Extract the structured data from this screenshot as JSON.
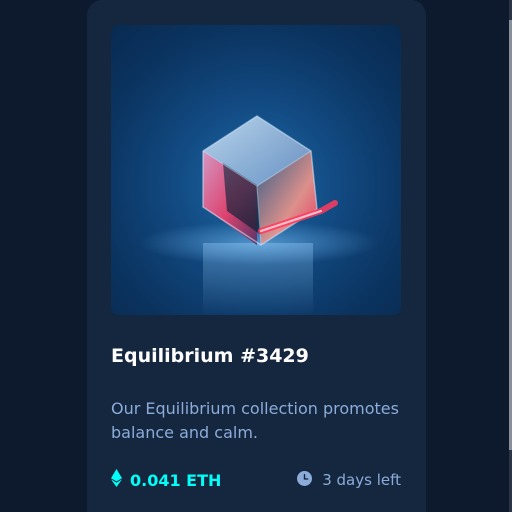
{
  "card": {
    "title": "Equilibrium #3429",
    "description": "Our Equilibrium collection promotes balance and calm.",
    "price": "0.041 ETH",
    "time_left": "3 days left"
  },
  "icons": {
    "price": "ethereum-icon",
    "time": "clock-icon"
  },
  "colors": {
    "page_background": "#0d1a2d",
    "card_background": "#15263f",
    "accent_cyan": "#00fff8",
    "soft_blue_text": "#8bacd9",
    "title_white": "#ffffff"
  }
}
